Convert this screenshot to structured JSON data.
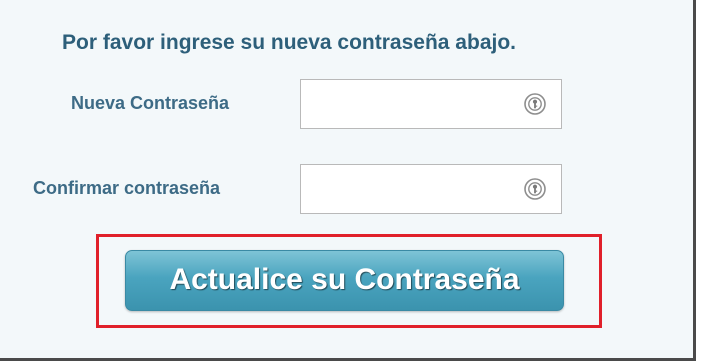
{
  "form": {
    "instruction": "Por favor ingrese su nueva contraseña abajo.",
    "new_password": {
      "label": "Nueva Contraseña",
      "value": "",
      "icon": "password-manager-icon"
    },
    "confirm_password": {
      "label": "Confirmar contraseña",
      "value": "",
      "icon": "password-manager-icon"
    },
    "submit_label": "Actualice su Contraseña"
  },
  "colors": {
    "header_text": "#2d5f7a",
    "label_text": "#3d6b86",
    "button": "#4aa4bf",
    "highlight_border": "#e0202a",
    "panel_background": "#f3f8fa"
  }
}
